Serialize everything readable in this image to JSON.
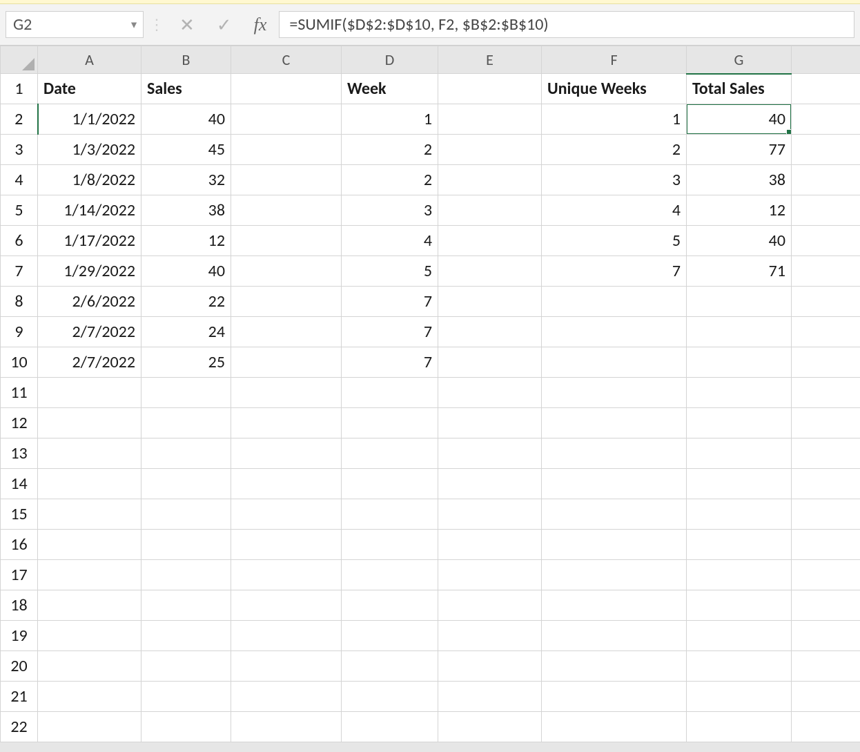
{
  "name_box": "G2",
  "formula": "=SUMIF($D$2:$D$10, F2, $B$2:$B$10)",
  "fx_label": "fx",
  "columns": [
    "A",
    "B",
    "C",
    "D",
    "E",
    "F",
    "G"
  ],
  "row_count": 22,
  "selected_cell": {
    "row": 2,
    "col": "G"
  },
  "headers": {
    "A": "Date",
    "B": "Sales",
    "D": "Week",
    "F": "Unique Weeks",
    "G": "Total Sales"
  },
  "rows": [
    {
      "A": "1/1/2022",
      "B": "40",
      "D": "1",
      "F": "1",
      "G": "40"
    },
    {
      "A": "1/3/2022",
      "B": "45",
      "D": "2",
      "F": "2",
      "G": "77"
    },
    {
      "A": "1/8/2022",
      "B": "32",
      "D": "2",
      "F": "3",
      "G": "38"
    },
    {
      "A": "1/14/2022",
      "B": "38",
      "D": "3",
      "F": "4",
      "G": "12"
    },
    {
      "A": "1/17/2022",
      "B": "12",
      "D": "4",
      "F": "5",
      "G": "40"
    },
    {
      "A": "1/29/2022",
      "B": "40",
      "D": "5",
      "F": "7",
      "G": "71"
    },
    {
      "A": "2/6/2022",
      "B": "22",
      "D": "7"
    },
    {
      "A": "2/7/2022",
      "B": "24",
      "D": "7"
    },
    {
      "A": "2/7/2022",
      "B": "25",
      "D": "7"
    }
  ]
}
